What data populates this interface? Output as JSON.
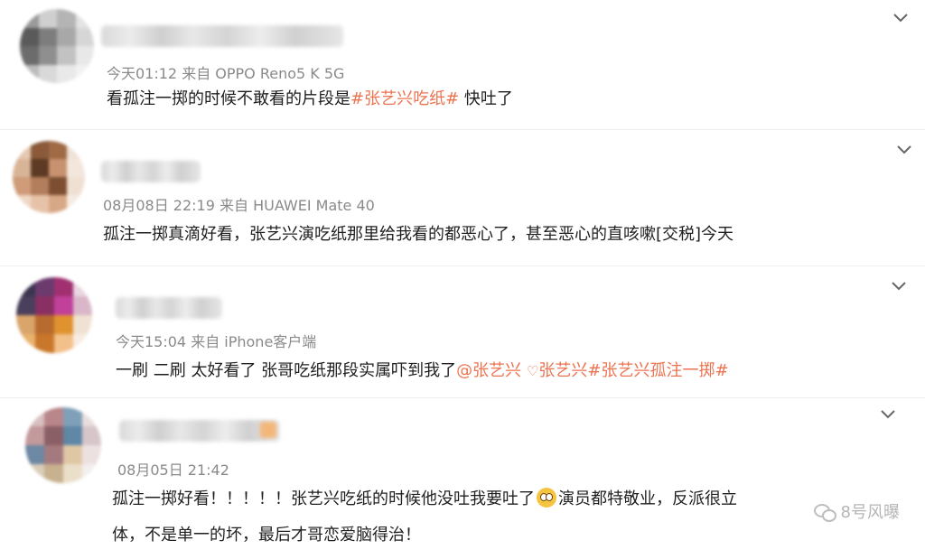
{
  "comments": [
    {
      "meta": "今天01:12 来自 OPPO Reno5 K 5G",
      "text_before": "看孤注一掷的时候不敢看的片段是",
      "tag1": "#张艺兴吃纸#",
      "text_after": " 快吐了"
    },
    {
      "meta": "08月08日 22:19 来自 HUAWEI Mate 40",
      "text": "孤注一掷真滴好看，张艺兴演吃纸那里给我看的都恶心了，甚至恶心的直咳嗽[交税]今天"
    },
    {
      "meta": "今天15:04 来自 iPhone客户端",
      "text_before": "一刷 二刷 太好看了 张哥吃纸那段实属吓到我了",
      "mention": "@张艺兴",
      "heart": "♡",
      "tag1": "张艺兴",
      "tag2": "#张艺兴孤注一掷#"
    },
    {
      "meta": "08月05日 21:42",
      "line1_before": "孤注一掷好看！！！！！张艺兴吃纸的时候他没吐我要吐了",
      "line1_after": "演员都特敬业，反派很立",
      "line2": "体，不是单一的坏，最后才哥恋爱脑得治！"
    }
  ],
  "watermark": "8号风曝",
  "icons": {
    "expand": "chevron-down-icon",
    "emoji": "shocked-face-emoji-icon",
    "watermark": "wechat-icon"
  },
  "colors": {
    "tag": "#eb7350",
    "meta": "#8a8a8a"
  }
}
